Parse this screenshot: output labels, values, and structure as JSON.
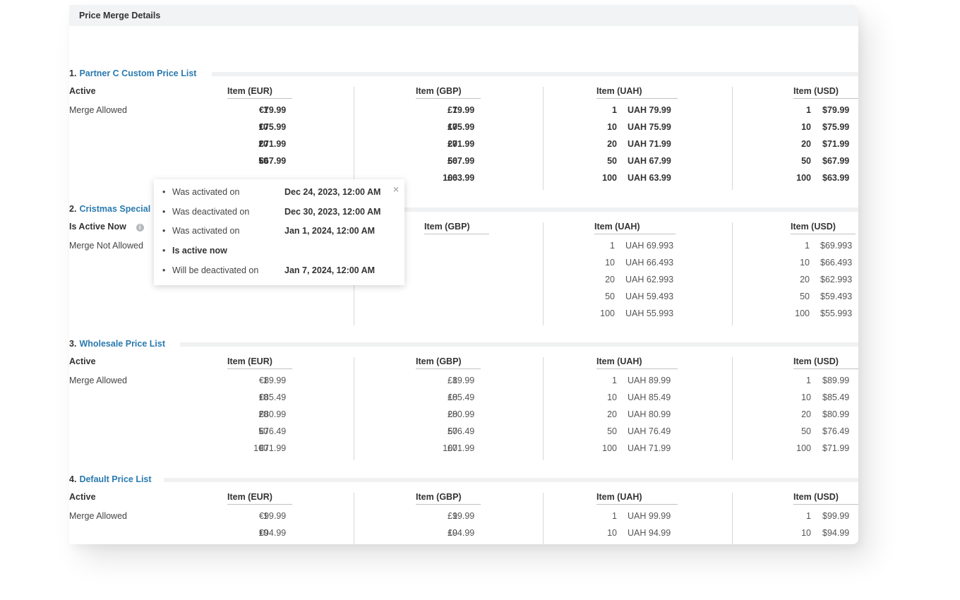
{
  "panel": {
    "title": "Price Merge Details"
  },
  "columns": [
    "Item (EUR)",
    "Item (GBP)",
    "Item (UAH)",
    "Item (USD)"
  ],
  "quantities": [
    "1",
    "10",
    "20",
    "50",
    "100"
  ],
  "sections": [
    {
      "number": "1.",
      "name": "Partner C Custom Price List",
      "status": "Active",
      "merge": "Merge Allowed",
      "bold": true,
      "prices": [
        [
          "€79.99",
          "€75.99",
          "€71.99",
          "€67.99",
          ""
        ],
        [
          "£79.99",
          "£75.99",
          "£71.99",
          "£67.99",
          "£63.99"
        ],
        [
          "UAH 79.99",
          "UAH 75.99",
          "UAH 71.99",
          "UAH 67.99",
          "UAH 63.99"
        ],
        [
          "$79.99",
          "$75.99",
          "$71.99",
          "$67.99",
          "$63.99"
        ]
      ]
    },
    {
      "number": "2.",
      "name": "Cristmas Special",
      "status": "Is Active Now",
      "merge": "Merge Not Allowed",
      "bold": false,
      "prices": [
        [],
        [],
        [
          "UAH 69.993",
          "UAH 66.493",
          "UAH 62.993",
          "UAH 59.493",
          "UAH 55.993"
        ],
        [
          "$69.993",
          "$66.493",
          "$62.993",
          "$59.493",
          "$55.993"
        ]
      ]
    },
    {
      "number": "3.",
      "name": "Wholesale Price List",
      "status": "Active",
      "merge": "Merge Allowed",
      "bold": false,
      "prices": [
        [
          "€89.99",
          "€85.49",
          "€80.99",
          "€76.49",
          "€71.99"
        ],
        [
          "£89.99",
          "£85.49",
          "£80.99",
          "£76.49",
          "£71.99"
        ],
        [
          "UAH 89.99",
          "UAH 85.49",
          "UAH 80.99",
          "UAH 76.49",
          "UAH 71.99"
        ],
        [
          "$89.99",
          "$85.49",
          "$80.99",
          "$76.49",
          "$71.99"
        ]
      ]
    },
    {
      "number": "4.",
      "name": "Default Price List",
      "status": "Active",
      "merge": "Merge Allowed",
      "bold": false,
      "prices": [
        [
          "€99.99",
          "€94.99"
        ],
        [
          "£99.99",
          "£94.99"
        ],
        [
          "UAH 99.99",
          "UAH 94.99"
        ],
        [
          "$99.99",
          "$94.99"
        ]
      ]
    }
  ],
  "tooltip": {
    "close": "×",
    "items": [
      {
        "label": "Was activated on",
        "date": "Dec 24, 2023, 12:00 AM",
        "strong": false
      },
      {
        "label": "Was deactivated on",
        "date": "Dec 30, 2023, 12:00 AM",
        "strong": false
      },
      {
        "label": "Was activated on",
        "date": "Jan 1, 2024, 12:00 AM",
        "strong": false
      },
      {
        "label": "Is active now",
        "date": "",
        "strong": true
      },
      {
        "label": "Will be deactivated on",
        "date": "Jan 7, 2024, 12:00 AM",
        "strong": false
      }
    ]
  },
  "icons": {
    "info": "info-icon",
    "close": "close-icon"
  }
}
